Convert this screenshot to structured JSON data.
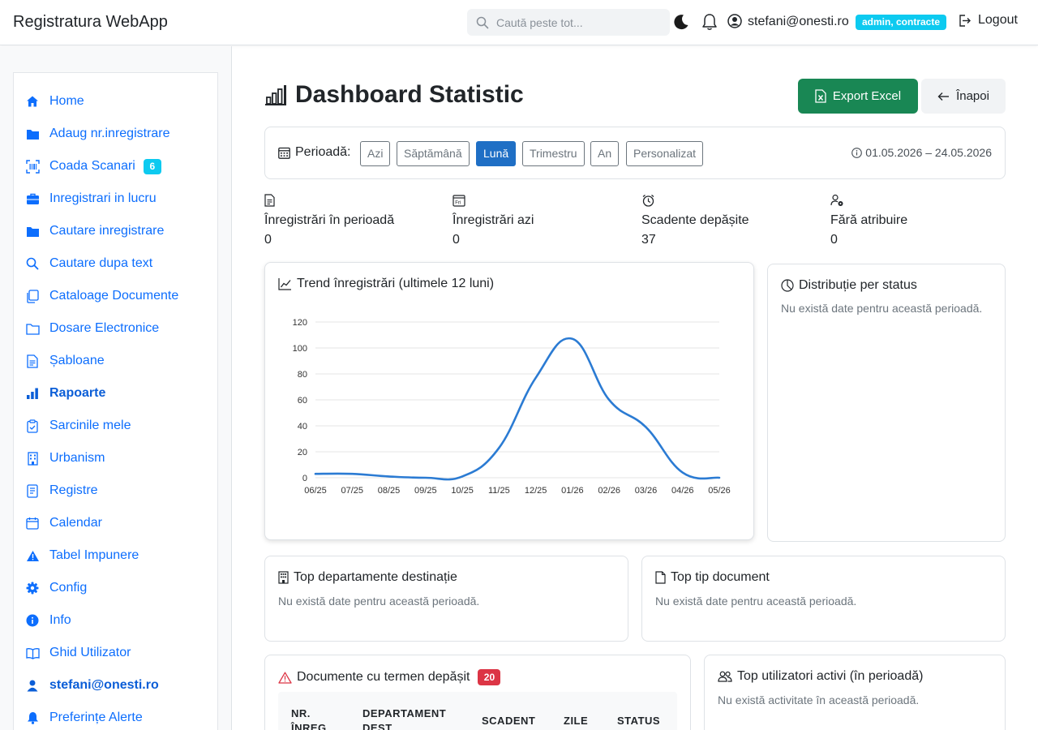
{
  "app": {
    "title": "Registratura WebApp"
  },
  "search": {
    "placeholder": "Caută peste tot..."
  },
  "user": {
    "email": "stefani@onesti.ro",
    "role": "admin, contracte",
    "logout_label": "Logout"
  },
  "sidebar": {
    "items": [
      {
        "label": "Home",
        "icon": "home-icon"
      },
      {
        "label": "Adaug nr.inregistrare",
        "icon": "folder-icon"
      },
      {
        "label": "Coada Scanari",
        "icon": "barcode-icon",
        "badge": "6"
      },
      {
        "label": "Inregistrari in lucru",
        "icon": "briefcase-icon"
      },
      {
        "label": "Cautare inregistrare",
        "icon": "folder-icon"
      },
      {
        "label": "Cautare dupa text",
        "icon": "search-icon"
      },
      {
        "label": "Cataloage Documente",
        "icon": "copy-icon"
      },
      {
        "label": "Dosare Electronice",
        "icon": "folder-outline-icon"
      },
      {
        "label": "Șabloane",
        "icon": "file-text-icon"
      },
      {
        "label": "Rapoarte",
        "icon": "bar-chart-icon",
        "active": true
      },
      {
        "label": "Sarcinile mele",
        "icon": "clipboard-check-icon"
      },
      {
        "label": "Urbanism",
        "icon": "building-icon"
      },
      {
        "label": "Registre",
        "icon": "journal-icon"
      },
      {
        "label": "Calendar",
        "icon": "calendar-icon"
      },
      {
        "label": "Tabel Impunere",
        "icon": "warning-icon"
      },
      {
        "label": "Config",
        "icon": "gear-icon"
      },
      {
        "label": "Info",
        "icon": "info-icon"
      },
      {
        "label": "Ghid Utilizator",
        "icon": "book-icon"
      },
      {
        "label": "stefani@onesti.ro",
        "icon": "person-icon",
        "bold": true
      },
      {
        "label": "Preferințe Alerte",
        "icon": "bell-fill-icon"
      }
    ]
  },
  "page": {
    "title": "Dashboard Statistic",
    "export_label": "Export Excel",
    "back_label": "Înapoi"
  },
  "period": {
    "label": "Perioadă:",
    "options": [
      "Azi",
      "Săptămână",
      "Lună",
      "Trimestru",
      "An",
      "Personalizat"
    ],
    "selected": "Lună",
    "range": "01.05.2026 – 24.05.2026"
  },
  "stats": [
    {
      "label": "Înregistrări în perioadă",
      "value": "0",
      "icon": "file-text-icon"
    },
    {
      "label": "Înregistrări azi",
      "value": "0",
      "icon": "calendar-day-icon"
    },
    {
      "label": "Scadente depășite",
      "value": "37",
      "icon": "alarm-icon"
    },
    {
      "label": "Fără atribuire",
      "value": "0",
      "icon": "person-gear-icon"
    }
  ],
  "cards": {
    "trend_title": "Trend înregistrări (ultimele 12 luni)",
    "status_title": "Distribuție per status",
    "status_empty": "Nu există date pentru această perioadă.",
    "dept_title": "Top departamente destinație",
    "dept_empty": "Nu există date pentru această perioadă.",
    "doctype_title": "Top tip document",
    "doctype_empty": "Nu există date pentru această perioadă.",
    "overdue_title": "Documente cu termen depășit",
    "overdue_count": "20",
    "overdue_columns": [
      "NR. ÎNREG.",
      "DEPARTAMENT DEST.",
      "SCADENT",
      "ZILE",
      "STATUS"
    ],
    "users_title": "Top utilizatori activi (în perioadă)",
    "users_empty": "Nu există activitate în această perioadă."
  },
  "chart_data": {
    "type": "line",
    "x": [
      "06/25",
      "07/25",
      "08/25",
      "09/25",
      "10/25",
      "11/25",
      "12/25",
      "01/26",
      "02/26",
      "03/26",
      "04/26",
      "05/26"
    ],
    "series": [
      {
        "values": [
          3,
          3,
          1,
          0,
          1,
          23,
          77,
          107,
          60,
          39,
          4,
          0
        ],
        "color": "#2b7bd3"
      }
    ],
    "yticks": [
      0,
      20,
      40,
      60,
      80,
      100,
      120
    ],
    "ylim": [
      0,
      120
    ],
    "grid": true
  },
  "colors": {
    "primary": "#0d6efd",
    "success": "#198754",
    "info": "#0dcaf0",
    "danger": "#dc3545",
    "line": "#2b7bd3"
  }
}
